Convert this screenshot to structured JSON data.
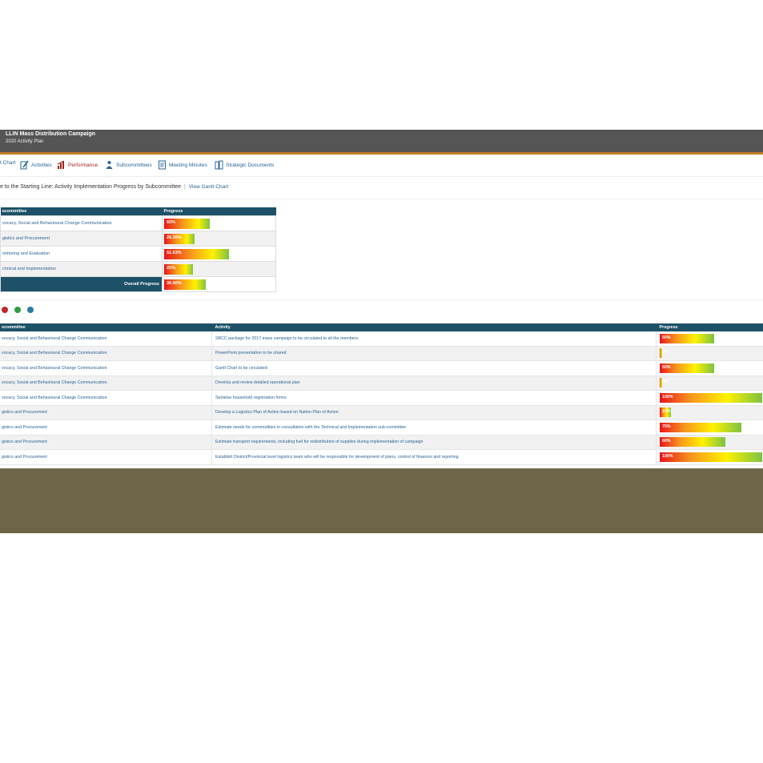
{
  "header": {
    "title": "LLIN Mass Distribution Campaign",
    "subtitle": "2020 Activity Plan"
  },
  "nav": {
    "items": [
      {
        "label": "t Chart",
        "icon": "none"
      },
      {
        "label": "Activities",
        "icon": "pencil-note-icon"
      },
      {
        "label": "Performance",
        "icon": "chart-icon",
        "active": true
      },
      {
        "label": "Subcommittees",
        "icon": "people-icon"
      },
      {
        "label": "Meeting Minutes",
        "icon": "notes-icon"
      },
      {
        "label": "Strategic Documents",
        "icon": "documents-icon"
      }
    ]
  },
  "heading": {
    "text": "e to the Starting Line: Activity Implementation Progress by Subcommittee",
    "separator": "|",
    "link": "View Gantt Chart"
  },
  "summary": {
    "headers": [
      "ocommittee",
      "Progress"
    ],
    "rows": [
      {
        "name": "vocacy, Social and Behavioural Change Communication",
        "progress": "60%",
        "fraction": 0.6
      },
      {
        "name": "gistics and Procurement",
        "progress": "26.36%",
        "fraction": 0.4
      },
      {
        "name": "onitoring and Evaluation",
        "progress": "51.63%",
        "fraction": 0.85
      },
      {
        "name": "chnical and Implementation",
        "progress": "25%",
        "fraction": 0.38
      }
    ],
    "overall_label": "Overall Progress",
    "overall_value": "36.00%",
    "overall_fraction": 0.55
  },
  "tools": [
    {
      "icon": "pdf-icon",
      "color": "#c0262d"
    },
    {
      "icon": "excel-icon",
      "color": "#2e9b44"
    },
    {
      "icon": "add-icon",
      "color": "#2a7aa8"
    }
  ],
  "detail": {
    "headers": [
      "ocommittee",
      "Activity",
      "Progress"
    ],
    "rows": [
      {
        "committee": "vocacy, Social and Behavioural Change Communication",
        "activity": "SBCC package for 2017 mass campaign to be circulated to all the members",
        "progress": "50%",
        "fraction": 0.53
      },
      {
        "committee": "vocacy, Social and Behavioural Change Communication",
        "activity": "PowerPoint presentation to be shared",
        "progress": "0%",
        "fraction": 0.02
      },
      {
        "committee": "vocacy, Social and Behavioural Change Communication",
        "activity": "Gantt Chart to be circulated",
        "progress": "50%",
        "fraction": 0.53
      },
      {
        "committee": "vocacy, Social and Behavioural Change Communication",
        "activity": "Develop and review detailed operational plan",
        "progress": "0%",
        "fraction": 0.02
      },
      {
        "committee": "vocacy, Social and Behavioural Change Communication",
        "activity": "Serialise household registration forms",
        "progress": "100%",
        "fraction": 1.0
      },
      {
        "committee": "gistics and Procurement",
        "activity": "Develop a Logistics Plan of Action based on Nation Plan of Action",
        "progress": "10%",
        "fraction": 0.11
      },
      {
        "committee": "gistics and Procurement",
        "activity": "Estimate needs for commodities in consultation with the Technical and Implementation sub-committee",
        "progress": "75%",
        "fraction": 0.8
      },
      {
        "committee": "gistics and Procurement",
        "activity": "Estimate transport requirements, including fuel for redistribution of supplies during implementation of campaign",
        "progress": "60%",
        "fraction": 0.64
      },
      {
        "committee": "gistics and Procurement",
        "activity": "Establish District/Provincial level logistics team who will be responsible for development of plans, control of finances and reporting",
        "progress": "100%",
        "fraction": 1.0
      }
    ]
  }
}
